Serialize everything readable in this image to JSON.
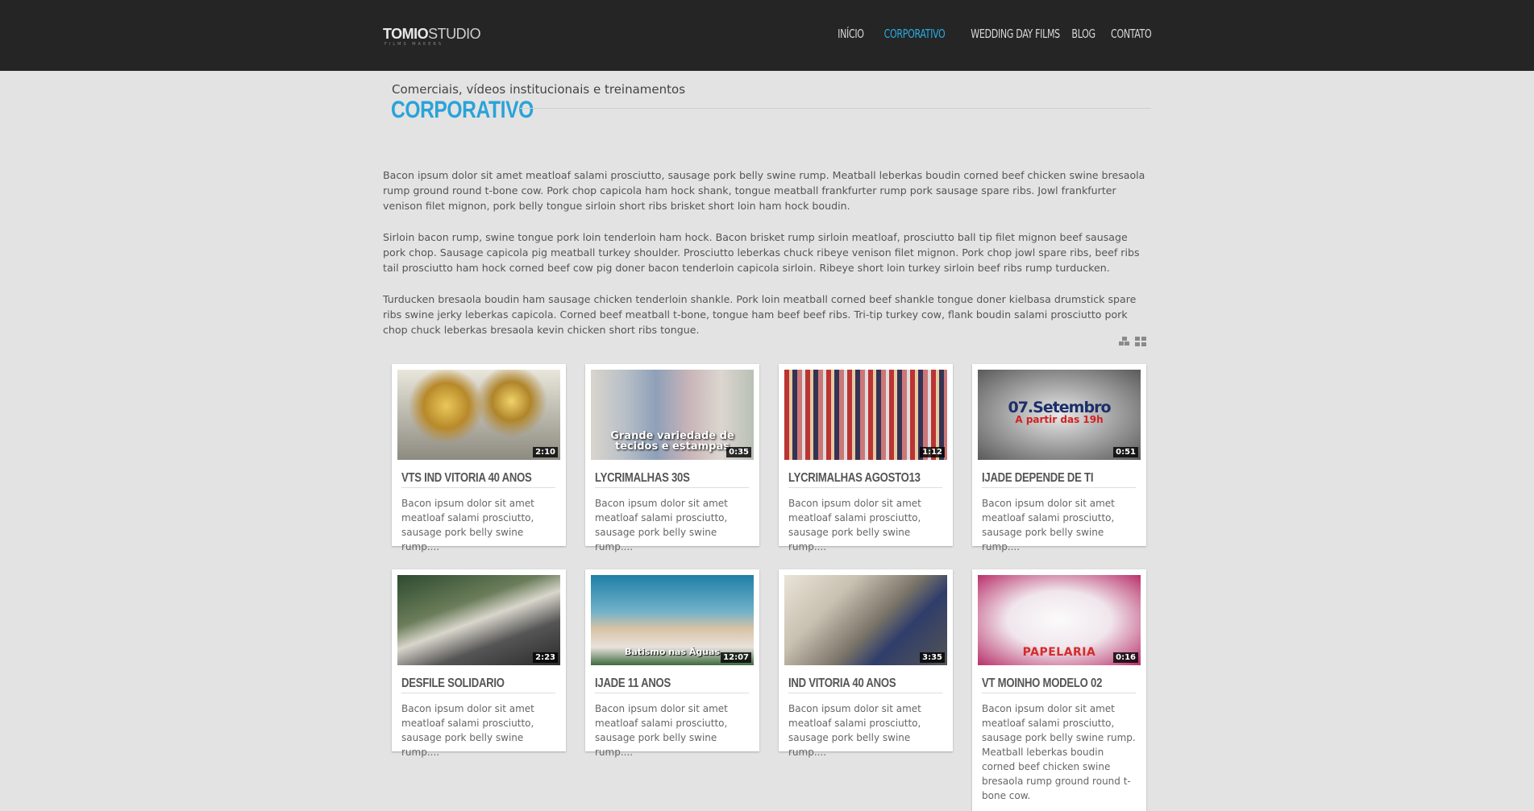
{
  "header": {
    "logo_bold": "TOMIO",
    "logo_light": "STUDIO",
    "logo_tag": "FILMS MAKERS",
    "nav": [
      {
        "label": "INÍCIO",
        "active": false
      },
      {
        "label": "CORPORATIVO",
        "active": true
      },
      {
        "label": "WEDDING DAY FILMS",
        "active": false
      },
      {
        "label": "BLOG",
        "active": false
      },
      {
        "label": "CONTATO",
        "active": false
      }
    ]
  },
  "section": {
    "subtitle": "Comerciais, vídeos institucionais e treinamentos",
    "title": "CORPORATIVO"
  },
  "intro": [
    "Bacon ipsum dolor sit amet meatloaf salami prosciutto, sausage pork belly swine rump. Meatball leberkas boudin corned beef chicken swine bresaola rump ground round t-bone cow. Pork chop capicola ham hock shank, tongue meatball frankfurter rump pork sausage spare ribs. Jowl frankfurter venison filet mignon, pork belly tongue sirloin short ribs brisket short loin ham hock boudin.",
    "Sirloin bacon rump, swine tongue pork loin tenderloin ham hock. Bacon brisket rump sirloin meatloaf, prosciutto ball tip filet mignon beef sausage pork chop. Sausage capicola pig meatball turkey shoulder. Prosciutto leberkas chuck ribeye venison filet mignon. Pork chop jowl spare ribs, beef ribs tail prosciutto ham hock corned beef cow pig doner bacon tenderloin capicola sirloin. Ribeye short loin turkey sirloin beef ribs rump turducken.",
    "Turducken bresaola boudin ham sausage chicken tenderloin shankle. Pork loin meatball corned beef shankle tongue doner kielbasa drumstick spare ribs swine jerky leberkas capicola. Corned beef meatball t-bone, tongue ham beef beef ribs. Tri-tip turkey cow, flank boudin salami prosciutto pork chop chuck leberkas bresaola kevin chicken short ribs tongue."
  ],
  "videos": [
    {
      "title": "VTS IND VITORIA 40 ANOS",
      "duration": "2:10",
      "excerpt": "Bacon ipsum dolor sit amet meatloaf salami prosciutto, sausage pork belly swine rump....",
      "overlay": "",
      "theme": "trophies"
    },
    {
      "title": "LYCRIMALHAS 30S",
      "duration": "0:35",
      "excerpt": "Bacon ipsum dolor sit amet meatloaf salami prosciutto, sausage pork belly swine rump....",
      "overlay": "Grande variedade de tecidos e estampas",
      "theme": "store"
    },
    {
      "title": "LYCRIMALHAS AGOSTO13",
      "duration": "1:12",
      "excerpt": "Bacon ipsum dolor sit amet meatloaf salami prosciutto, sausage pork belly swine rump....",
      "overlay": "",
      "theme": "threads"
    },
    {
      "title": "IJADE DEPENDE DE TI",
      "duration": "0:51",
      "excerpt": "Bacon ipsum dolor sit amet meatloaf salami prosciutto, sausage pork belly swine rump....",
      "overlay": "07.Setembro",
      "overlay2": "A partir das 19h",
      "theme": "words"
    },
    {
      "title": "DESFILE SOLIDARIO",
      "duration": "2:23",
      "excerpt": "Bacon ipsum dolor sit amet meatloaf salami prosciutto, sausage pork belly swine rump....",
      "overlay": "",
      "theme": "photos"
    },
    {
      "title": "IJADE 11 ANOS",
      "duration": "12:07",
      "excerpt": "Bacon ipsum dolor sit amet meatloaf salami prosciutto, sausage pork belly swine rump....",
      "overlay": "Batismo nas Águas",
      "theme": "pool"
    },
    {
      "title": "IND VITORIA 40 ANOS",
      "duration": "3:35",
      "excerpt": "Bacon ipsum dolor sit amet meatloaf salami prosciutto, sausage pork belly swine rump....",
      "overlay": "",
      "theme": "kitchen"
    },
    {
      "title": "VT MOINHO MODELO 02",
      "duration": "0:16",
      "excerpt": "Bacon ipsum dolor sit amet meatloaf salami prosciutto, sausage pork belly swine rump. Meatball leberkas boudin corned beef chicken swine bresaola rump ground round t-bone cow.",
      "overlay": "PAPELARIA",
      "theme": "stationery"
    }
  ],
  "colors": {
    "accent": "#29abe2",
    "topbar": "#252525"
  }
}
